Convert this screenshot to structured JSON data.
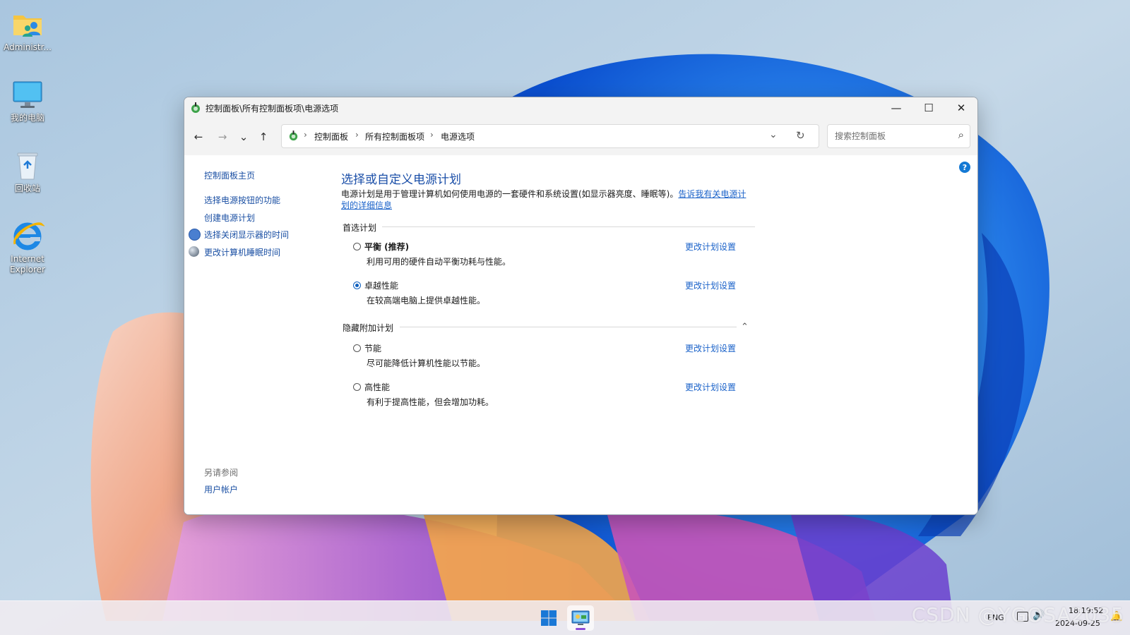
{
  "desktop": {
    "icons": [
      {
        "label": "Administr..."
      },
      {
        "label": "我的电脑"
      },
      {
        "label": "回收站"
      },
      {
        "label": "Internet Explorer"
      }
    ]
  },
  "window": {
    "title": "控制面板\\所有控制面板项\\电源选项",
    "minimize_glyph": "—",
    "maximize_glyph": "☐",
    "close_glyph": "✕"
  },
  "nav": {
    "back_glyph": "←",
    "forward_glyph": "→",
    "recent_glyph": "⌄",
    "up_glyph": "↑",
    "breadcrumb": [
      "控制面板",
      "所有控制面板项",
      "电源选项"
    ],
    "breadcrumb_sep": "›",
    "dropdown_glyph": "⌄",
    "refresh_glyph": "↻",
    "search_placeholder": "搜索控制面板",
    "search_glyph": "⌕"
  },
  "sidebar": {
    "home": "控制面板主页",
    "links": [
      "选择电源按钮的功能",
      "创建电源计划",
      "选择关闭显示器的时间",
      "更改计算机睡眠时间"
    ],
    "see_also_label": "另请参阅",
    "see_also_links": [
      "用户帐户"
    ]
  },
  "main": {
    "title": "选择或自定义电源计划",
    "intro_text": "电源计划是用于管理计算机如何使用电源的一套硬件和系统设置(如显示器亮度、睡眠等)。",
    "intro_link": "告诉我有关电源计划的详细信息",
    "preferred_label": "首选计划",
    "hidden_label": "隐藏附加计划",
    "collapse_glyph": "⌃",
    "help_glyph": "?",
    "change_link": "更改计划设置",
    "plans": [
      {
        "name": "平衡 (推荐)",
        "desc": "利用可用的硬件自动平衡功耗与性能。",
        "selected": false
      },
      {
        "name": "卓越性能",
        "desc": "在较高端电脑上提供卓越性能。",
        "selected": true
      },
      {
        "name": "节能",
        "desc": "尽可能降低计算机性能以节能。",
        "selected": false
      },
      {
        "name": "高性能",
        "desc": "有利于提高性能，但会增加功耗。",
        "selected": false
      }
    ]
  },
  "taskbar": {
    "lang": "ENG",
    "time": "18:19:52",
    "date": "2024-09-25",
    "watermark": "CSDN @YGOSA2035"
  },
  "colors": {
    "accent": "#0e5fbe",
    "link": "#1a62c9"
  }
}
